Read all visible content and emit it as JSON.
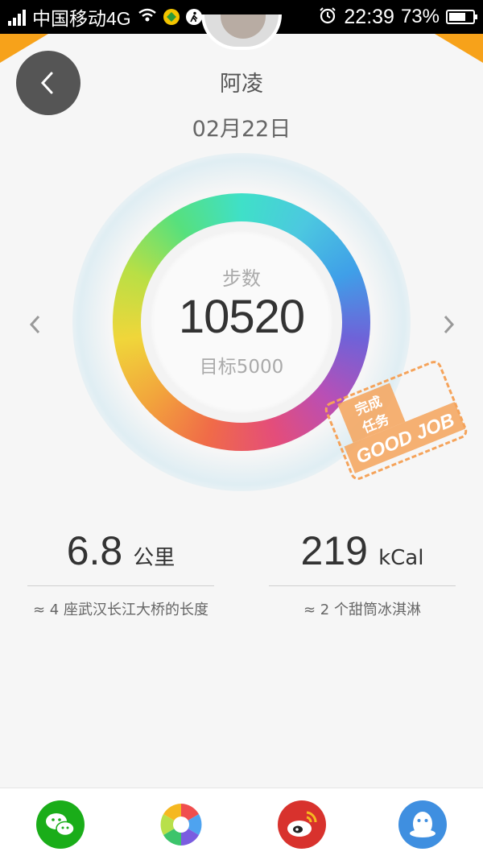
{
  "status_bar": {
    "carrier": "中国移动4G",
    "time": "22:39",
    "battery_percent": "73%",
    "battery_level": 0.73,
    "icons": [
      "signal-icon",
      "wifi-icon",
      "app-notification-icon",
      "running-app-icon",
      "alarm-icon",
      "battery-icon"
    ]
  },
  "header": {
    "username": "阿凌",
    "date": "02月22日"
  },
  "ring": {
    "label": "步数",
    "value": "10520",
    "goal": "目标5000"
  },
  "stamp": {
    "line1": "完成",
    "line2": "任务",
    "line3": "GOOD JOB",
    "color": "#f5a35a"
  },
  "stats": {
    "distance": {
      "value": "6.8",
      "unit": "公里",
      "description": "≈ 4 座武汉长江大桥的长度"
    },
    "calories": {
      "value": "219",
      "unit": "kCal",
      "description": "≈ 2 个甜筒冰淇淋"
    }
  },
  "share": {
    "items": [
      "wechat-icon",
      "moments-icon",
      "weibo-icon",
      "qq-icon"
    ],
    "colors": {
      "wechat": "#1aad19",
      "weibo": "#d8322d",
      "qq": "#3f8fe0"
    }
  },
  "theme": {
    "accent_orange": "#f7a21a",
    "back_button": "#555555"
  }
}
